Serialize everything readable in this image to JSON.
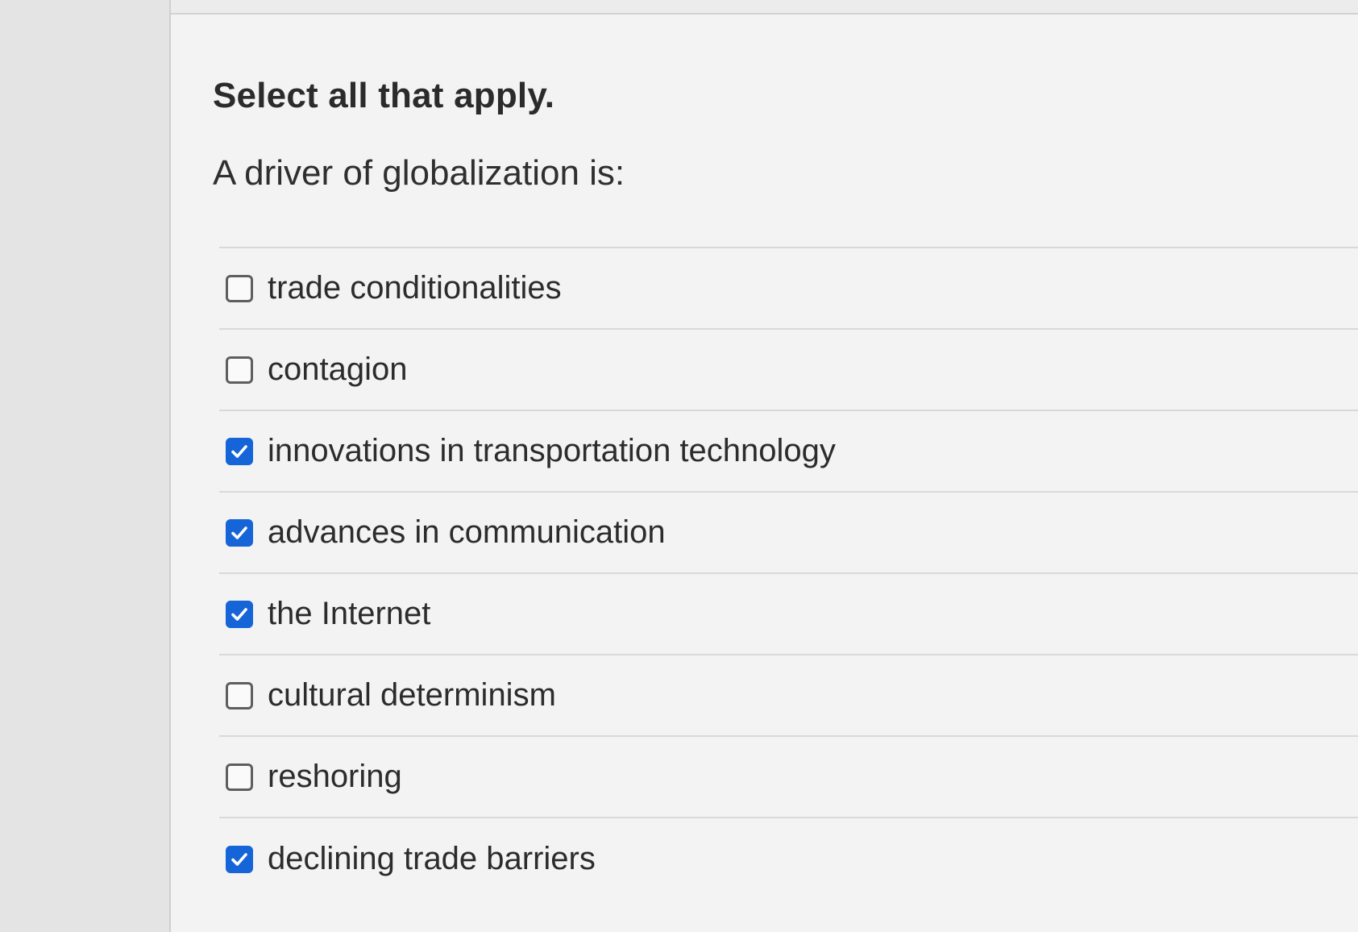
{
  "instruction": "Select all that apply.",
  "question": "A driver of globalization is:",
  "options": [
    {
      "label": "trade conditionalities",
      "checked": false
    },
    {
      "label": "contagion",
      "checked": false
    },
    {
      "label": "innovations in transportation technology",
      "checked": true
    },
    {
      "label": "advances in communication",
      "checked": true
    },
    {
      "label": "the Internet",
      "checked": true
    },
    {
      "label": "cultural determinism",
      "checked": false
    },
    {
      "label": "reshoring",
      "checked": false
    },
    {
      "label": "declining trade barriers",
      "checked": true
    }
  ],
  "colors": {
    "checked_fill": "#1565d8",
    "checkmark": "#ffffff",
    "unchecked_border": "#5e5e5e",
    "text": "#2c2c2c"
  },
  "icons": {
    "checked": "checkmark-icon"
  }
}
